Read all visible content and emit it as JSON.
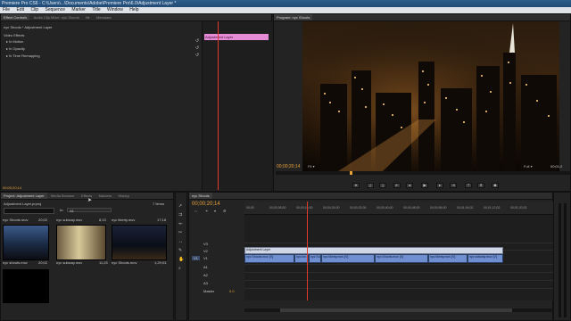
{
  "window": {
    "title": "Premiere Pro CS6 - C:\\Users\\...\\Documents\\Adobe\\Premiere Pro\\6.0\\Adjustment Layer *"
  },
  "menu": [
    "File",
    "Edit",
    "Clip",
    "Sequence",
    "Marker",
    "Title",
    "Window",
    "Help"
  ],
  "effect_controls": {
    "tabs": [
      "Effect Controls",
      "Audio Clip Mixer: nyc Shoots",
      "Mt",
      "Metadata"
    ],
    "header": "nyc Shoots * Adjustment Layer",
    "section": "Video Effects",
    "effects": [
      "Motion",
      "Opacity",
      "Time Remapping"
    ],
    "clip_label": "Adjustment Layer",
    "timecode": "00;00;20;14"
  },
  "program_monitor": {
    "tab": "Program: nyc Shoots",
    "timecode": "00;00;20;14",
    "zoom": "Fit",
    "quality": "Full",
    "duration": "00;01;2"
  },
  "project_panel": {
    "tabs": [
      "Project: Adjustment Layer",
      "Media Browser",
      "Effects",
      "Markers",
      "History"
    ],
    "project_file": "Adjustment Layer.prproj",
    "items_count": "7 Items",
    "in_label": "In:",
    "in_value": "All",
    "thumbs": [
      {
        "name": "nyc Shoots.mov",
        "dur": "20;02"
      },
      {
        "name": "nyc subway.mov",
        "dur": "8;13"
      },
      {
        "name": "nyc liberty.mov",
        "dur": "17;18"
      },
      {
        "name": "nyc shoots.mov",
        "dur": "20;02"
      },
      {
        "name": "nyc subway.mov",
        "dur": "11;25"
      },
      {
        "name": "nyc Shoots.mov",
        "dur": "1;29;03"
      },
      {
        "name": "",
        "dur": ""
      }
    ]
  },
  "timeline": {
    "tab": "nyc Shoots",
    "timecode": "00;00;20;14",
    "ruler": [
      "00;00",
      "00;00;08;00",
      "00;00;16;00",
      "00;00;24;00",
      "00;00;32;00",
      "00;00;40;00",
      "00;00;48;00",
      "00;00;56;00",
      "00;01;04;02",
      "00;01;12;02",
      "00;01;20;02"
    ],
    "tracks": [
      "V3",
      "V2",
      "V1",
      "A1",
      "A2",
      "A3",
      "Master"
    ],
    "master_value": "0.0",
    "clips_v2": [
      {
        "label": "Adjustment Layer"
      }
    ],
    "clips_v1": [
      {
        "label": "nyc Shoots.mov [V]"
      },
      {
        "label": "nyc km..."
      },
      {
        "label": "nyc Subway"
      },
      {
        "label": "nyc liberty.mov [V]"
      },
      {
        "label": "nyc Shoots.mov [V]"
      },
      {
        "label": "nyc liberty.mov [V]"
      },
      {
        "label": "nyc subway.mov [V]"
      }
    ]
  },
  "colors": {
    "accent": "#e8a23b",
    "clip": "#6f8fd0",
    "adjustment": "#cfd6e6",
    "pink": "#e58bd6",
    "playhead": "#e03a2a"
  }
}
